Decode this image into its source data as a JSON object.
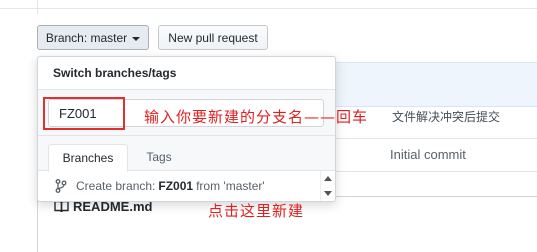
{
  "toolbar": {
    "branch_label": "Branch: master",
    "new_pr_label": "New pull request"
  },
  "dropdown": {
    "header": "Switch branches/tags",
    "filter_value": "FZ001",
    "tabs": [
      {
        "label": "Branches",
        "active": true
      },
      {
        "label": "Tags",
        "active": false
      }
    ],
    "create_prefix": "Create branch:",
    "create_name": "FZ001",
    "create_suffix": "from 'master'"
  },
  "background": {
    "commit_message_fragment": "文件解决冲突后提交",
    "commit_cell": "Initial commit",
    "readme_title": "README.md"
  },
  "annotations": {
    "note_input": "输入你要新建的分支名——回车",
    "note_click": "点击这里新建",
    "highlight_color": "#e03030"
  },
  "icons": {
    "branch": "git-branch-icon",
    "book": "book-icon",
    "caret": "caret-down-icon"
  }
}
